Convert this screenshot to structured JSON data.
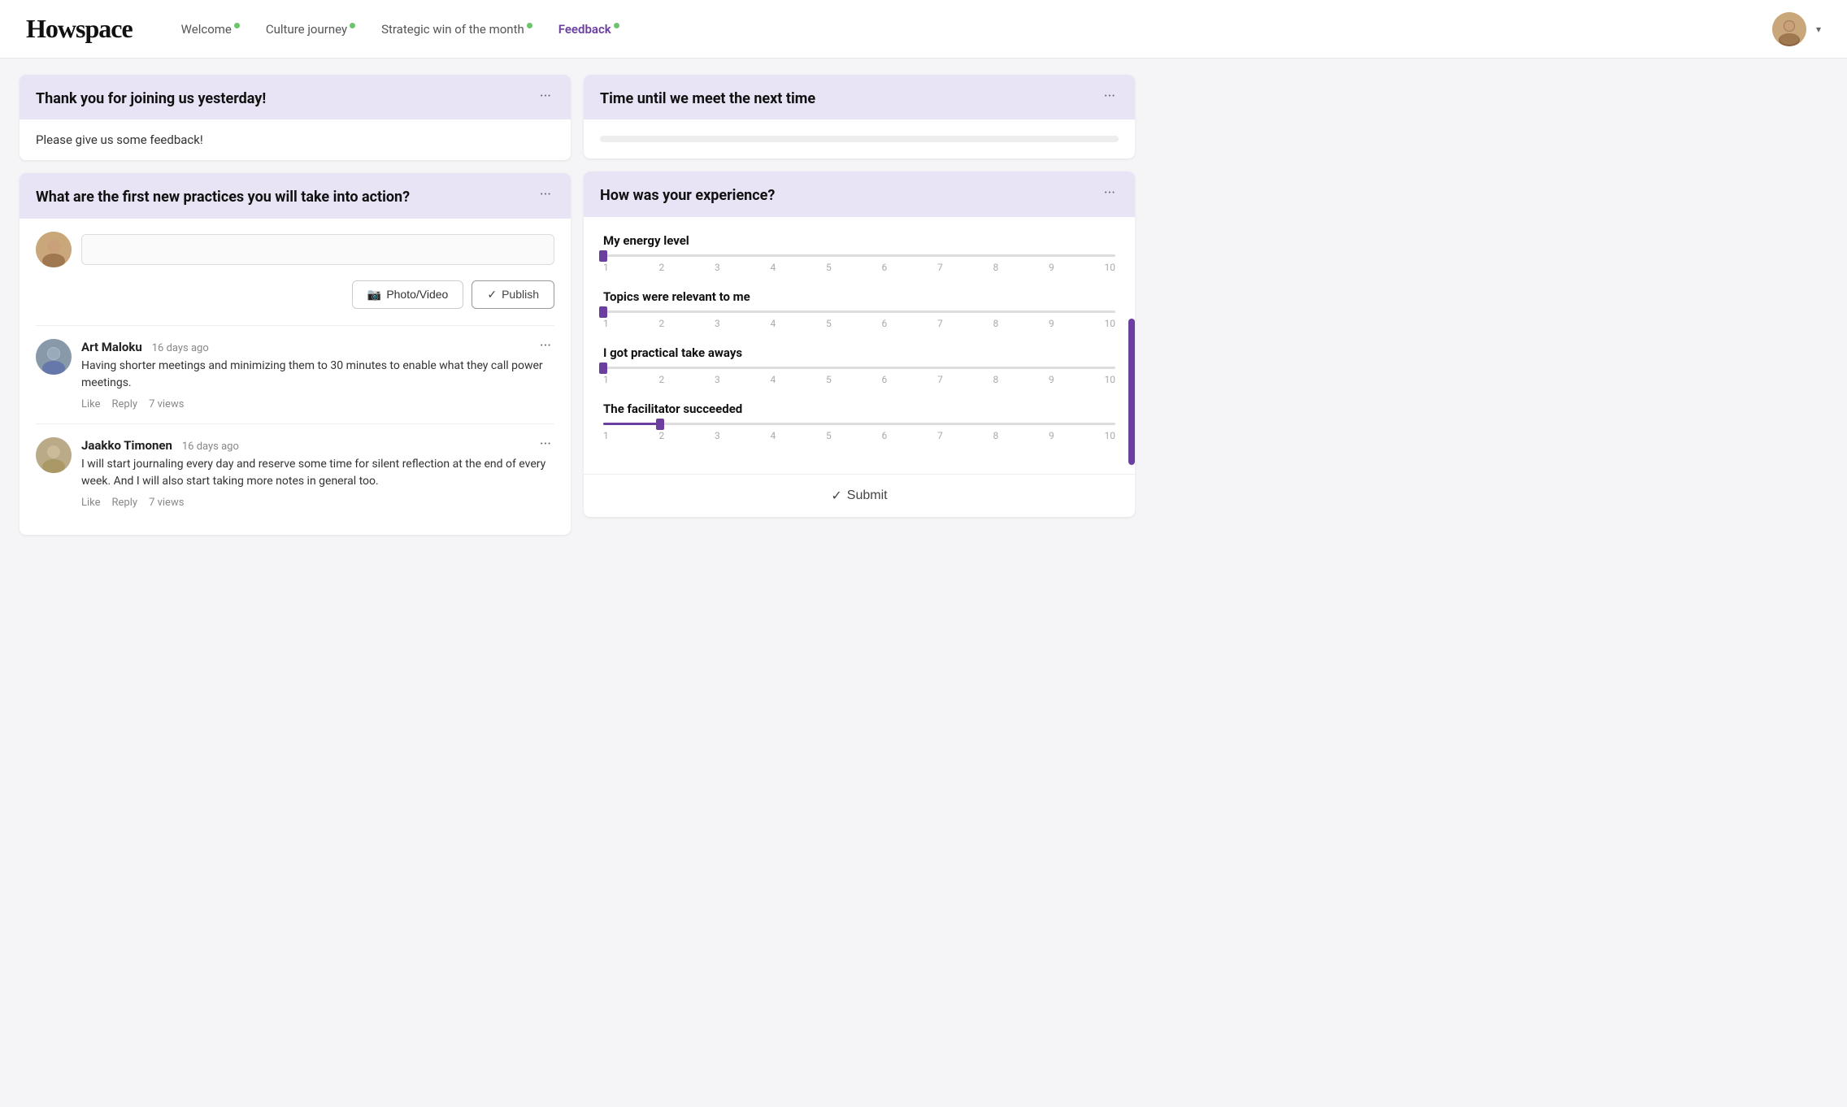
{
  "logo": "Howspace",
  "nav": {
    "links": [
      {
        "id": "welcome",
        "label": "Welcome",
        "active": false
      },
      {
        "id": "culture-journey",
        "label": "Culture journey",
        "active": false
      },
      {
        "id": "strategic-win",
        "label": "Strategic win of the month",
        "active": false
      },
      {
        "id": "feedback",
        "label": "Feedback",
        "active": true
      }
    ]
  },
  "cards": {
    "thank_you": {
      "title": "Thank you for joining us yesterday!",
      "body": "Please give us some feedback!"
    },
    "time_until": {
      "title": "Time until we meet the next time"
    },
    "practices": {
      "title": "What are the first new practices you will take into action?",
      "buttons": {
        "photo": "Photo/Video",
        "publish": "Publish"
      },
      "comments": [
        {
          "author": "Art Maloku",
          "time_ago": "16 days ago",
          "text": "Having shorter meetings and minimizing them to 30 minutes to enable what they call power meetings.",
          "likes": "Like",
          "reply": "Reply",
          "views": "7 views"
        },
        {
          "author": "Jaakko Timonen",
          "time_ago": "16 days ago",
          "text": "I will start journaling every day and reserve some time for silent reflection at the end of every week. And I will also start taking more notes in general too.",
          "likes": "Like",
          "reply": "Reply",
          "views": "7 views"
        }
      ]
    },
    "experience": {
      "title": "How was your experience?",
      "sliders": [
        {
          "label": "My energy level",
          "value": 1,
          "min": 1,
          "max": 10
        },
        {
          "label": "Topics were relevant to me",
          "value": 1,
          "min": 1,
          "max": 10
        },
        {
          "label": "I got practical take aways",
          "value": 1,
          "min": 1,
          "max": 10
        },
        {
          "label": "The facilitator succeeded",
          "value": 2,
          "min": 1,
          "max": 10
        }
      ],
      "submit_label": "Submit"
    }
  },
  "icons": {
    "dots": "···",
    "camera": "📷",
    "check": "✓",
    "chevron_down": "▾"
  }
}
